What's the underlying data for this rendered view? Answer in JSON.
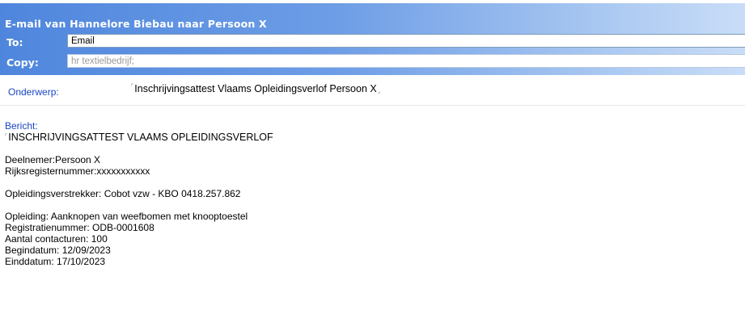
{
  "email": {
    "header_title": "E-mail van Hannelore Biebau naar Persoon X",
    "to_label": "To:",
    "to_value": "Email",
    "copy_label": "Copy:",
    "copy_value": "hr textielbedrijf;",
    "subject_label": "Onderwerp:",
    "subject_value": "Inschrijvingsattest Vlaams Opleidingsverlof Persoon X",
    "message_label": "Bericht:",
    "message": {
      "heading": "INSCHRIJVINGSATTEST VLAAMS OPLEIDINGSVERLOF",
      "participant": "Deelnemer:Persoon X",
      "national_register": "Rijksregisternummer:xxxxxxxxxxx",
      "provider": "Opleidingsverstrekker: Cobot vzw - KBO 0418.257.862",
      "training": "Opleiding: Aanknopen van weefbomen met knooptoestel",
      "registration_number": "Registratienummer: ODB-0001608",
      "contact_hours": "Aantal contacturen: 100",
      "start_date": "Begindatum: 12/09/2023",
      "end_date": "Einddatum: 17/10/2023"
    }
  },
  "colors": {
    "header_gradient_start": "#4f86dd",
    "header_gradient_end": "#c9ddf7",
    "label_blue": "#1a45c5"
  }
}
